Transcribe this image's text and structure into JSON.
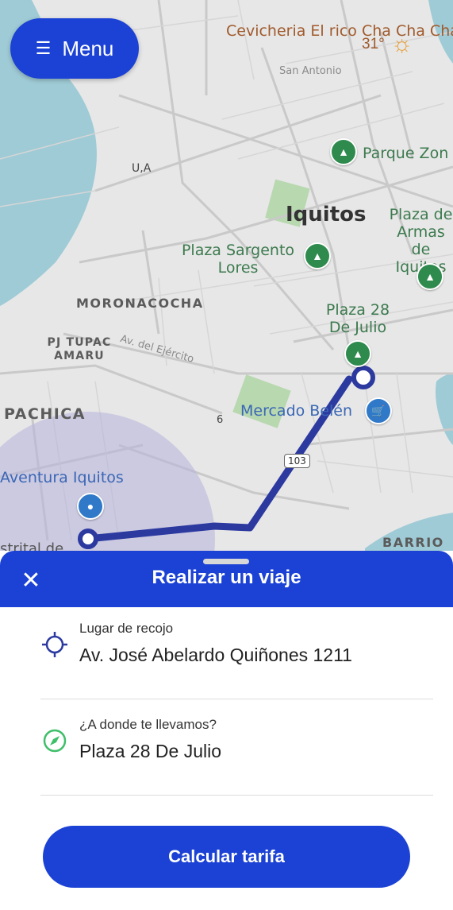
{
  "menu": {
    "label": "Menu",
    "icon": "menu-icon"
  },
  "weather": {
    "temperature": "31°",
    "icon": "sun-icon"
  },
  "map": {
    "labels": {
      "cevicheria": "Cevicheria El rico Cha Cha Cha",
      "san_antonio": "San Antonio",
      "parque_zon": "Parque Zon",
      "ua": "U,A",
      "iquitos": "Iquitos",
      "plaza_armas": "Plaza de Armas de Iquitos",
      "plaza_sargento": "Plaza Sargento Lores",
      "moronacocha": "MORONACOCHA",
      "plaza_28": "Plaza 28 De Julio",
      "pj_tupac": "PJ TUPAC AMARU",
      "av_ejercito": "Av. del Ejército",
      "pachica": "PACHICA",
      "mercado": "Mercado Belén",
      "six": "6",
      "route_103": "103",
      "aventura": "Aventura Iquitos",
      "distrital": "strital de",
      "barrio": "BARRIO"
    },
    "colors": {
      "route": "#2c3aa0",
      "water": "#9fcbd6",
      "park": "#b8d8b0",
      "radius": "#b7b3dc"
    }
  },
  "sheet": {
    "title": "Realizar un viaje",
    "close_icon": "close-icon",
    "pickup": {
      "label": "Lugar de recojo",
      "value": "Av. José Abelardo Quiñones 1211",
      "icon": "crosshair-icon"
    },
    "destination": {
      "label": "¿A donde te llevamos?",
      "value": "Plaza 28 De Julio",
      "icon": "compass-icon"
    },
    "calculate_label": "Calcular tarifa"
  },
  "theme": {
    "primary": "#1b42d4",
    "pickup_icon_color": "#2c3aa0",
    "destination_icon_color": "#3fbf6a"
  }
}
